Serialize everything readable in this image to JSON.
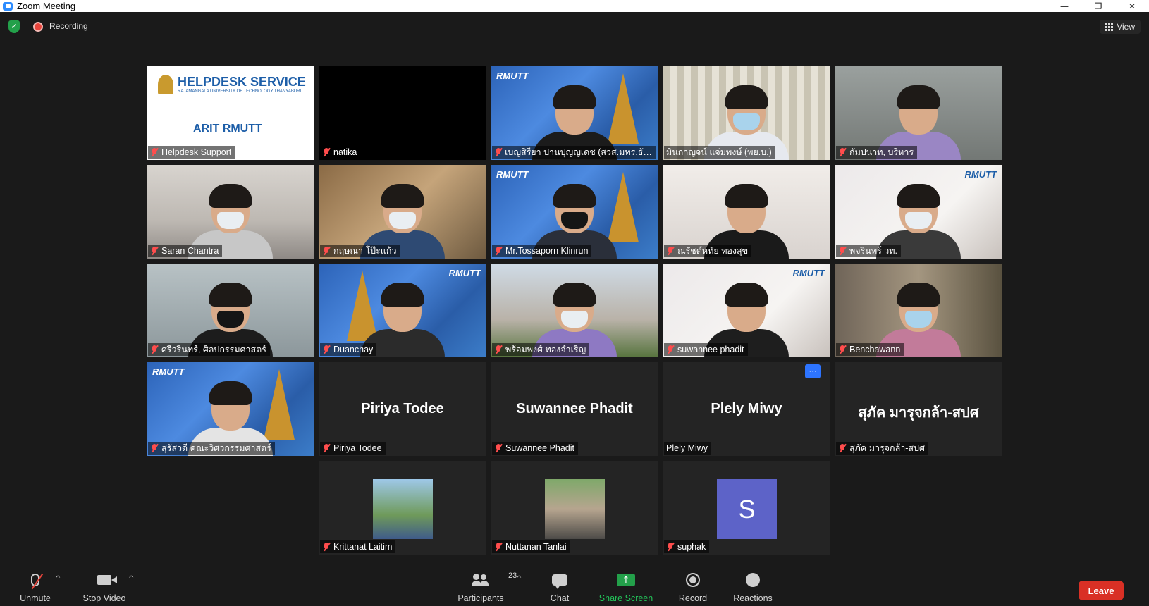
{
  "window": {
    "title": "Zoom Meeting",
    "controls": [
      "—",
      "❐",
      "✕"
    ]
  },
  "topbar": {
    "recording_label": "Recording",
    "view_label": "View"
  },
  "tiles": [
    {
      "name": "Helpdesk Support",
      "muted": true
    },
    {
      "name": "natika",
      "muted": true
    },
    {
      "name": "เบญสิรียา ปานปุญญเดช (สวส.มทร.ธัญบุรี)",
      "muted": true
    },
    {
      "name": "มินกาญจน์ แจ่มพงษ์ (พย.บ.)",
      "muted": false
    },
    {
      "name": "กัมปนาท, บริหาร",
      "muted": true
    },
    {
      "name": "Saran Chantra",
      "muted": true
    },
    {
      "name": "กฤษณา โป๊ะแก้ว",
      "muted": true
    },
    {
      "name": "Mr.Tossaporn Klinrun",
      "muted": true
    },
    {
      "name": "ณรัชต์หทัย ทองสุข",
      "muted": true
    },
    {
      "name": "พจรินทร์ วท.",
      "muted": true
    },
    {
      "name": "ศรีวรินทร์, ศิลปกรรมศาสตร์",
      "muted": true
    },
    {
      "name": "Duanchay",
      "muted": true
    },
    {
      "name": "พร้อมพงศ์ ทองจำเริญ",
      "muted": true
    },
    {
      "name": "suwannee phadit",
      "muted": true
    },
    {
      "name": "Benchawann",
      "muted": true
    },
    {
      "name": "สุรัสวดี คณะวิศวกรรมศาสตร์",
      "muted": true
    },
    {
      "name": "Piriya Todee",
      "muted": true,
      "display_name": "Piriya Todee"
    },
    {
      "name": "Suwannee Phadit",
      "muted": true,
      "display_name": "Suwannee Phadit"
    },
    {
      "name": "Plely Miwy",
      "muted": false,
      "display_name": "Plely Miwy"
    },
    {
      "name": "สุภัค มารุจกล้า-สปศ",
      "muted": true,
      "display_name": "สุภัค มารุจกล้า-สปศ"
    },
    {
      "name": "Krittanat Laitim",
      "muted": true
    },
    {
      "name": "Nuttanan Tanlai",
      "muted": true
    },
    {
      "name": "suphak",
      "muted": true,
      "avatar_letter": "S"
    }
  ],
  "helpdesk_card": {
    "title": "HELPDESK SERVICE",
    "subtitle": "RAJAMANGALA UNIVERSITY OF TECHNOLOGY THANYABURI",
    "footer": "ARIT RMUTT"
  },
  "rmutt_logo_text": "RMUTT",
  "more_button": "···",
  "toolbar": {
    "unmute": "Unmute",
    "stop_video": "Stop Video",
    "participants": "Participants",
    "participants_count": "23",
    "chat": "Chat",
    "share_screen": "Share Screen",
    "record": "Record",
    "reactions": "Reactions",
    "leave": "Leave"
  },
  "colors": {
    "active_speaker_border": "#b9e34a",
    "leave": "#d93025",
    "share": "#23a04a",
    "avatar": "#5d63c8"
  }
}
